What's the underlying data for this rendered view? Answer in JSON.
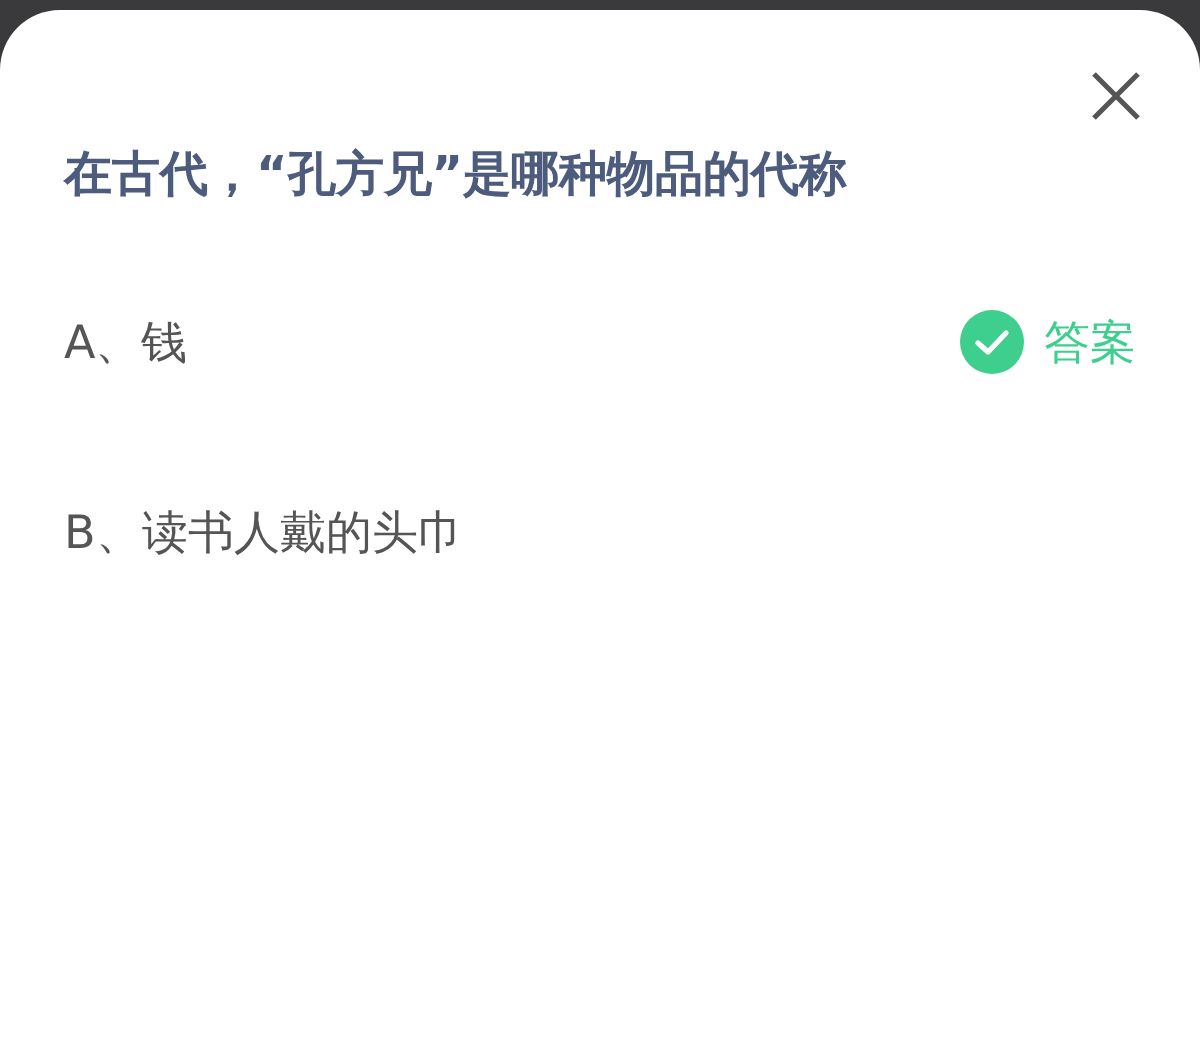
{
  "question": "在古代，“孔方兄”是哪种物品的代称",
  "options": [
    {
      "label": "A、钱",
      "correct": true
    },
    {
      "label": "B、读书人戴的头巾",
      "correct": false
    }
  ],
  "answer_label": "答案"
}
